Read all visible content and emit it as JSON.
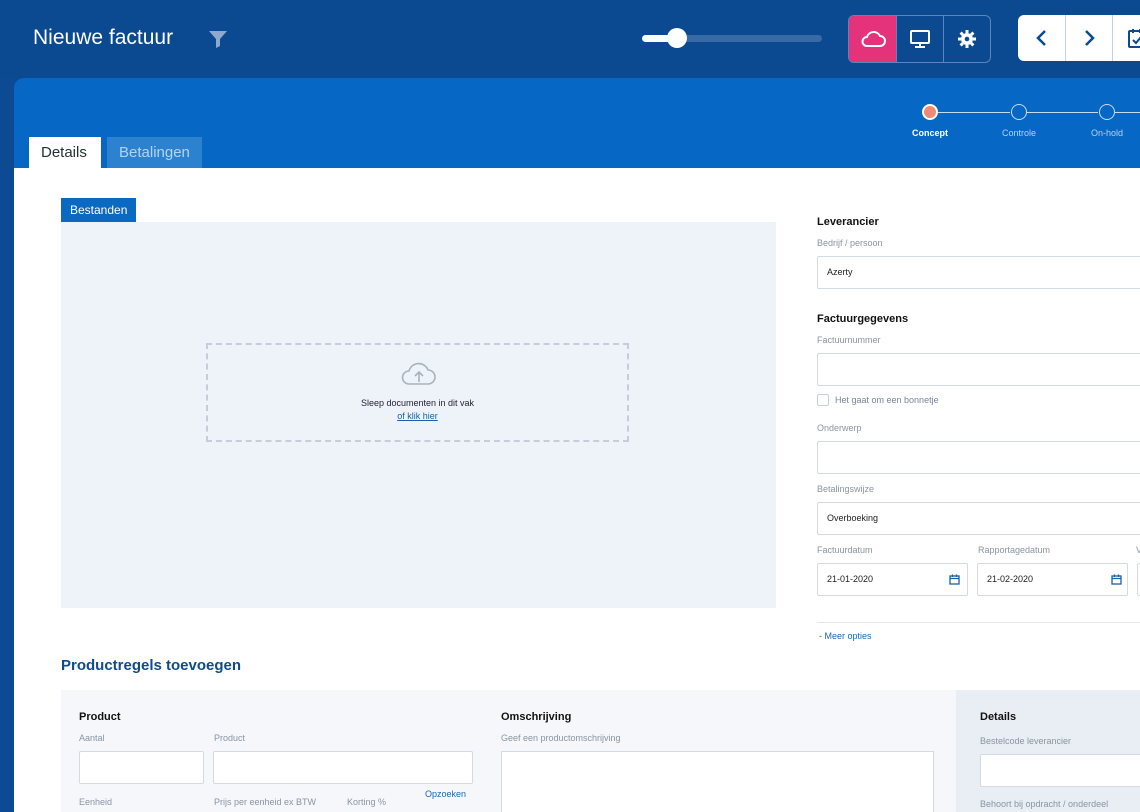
{
  "header": {
    "title": "Nieuwe factuur"
  },
  "tabs": [
    {
      "label": "Details",
      "active": true
    },
    {
      "label": "Betalingen",
      "active": false
    }
  ],
  "steps": [
    {
      "label": "Concept",
      "current": true
    },
    {
      "label": "Controle",
      "current": false
    },
    {
      "label": "On-hold",
      "current": false
    }
  ],
  "files": {
    "badge": "Bestanden",
    "drop_text": "Sleep documenten in dit vak",
    "drop_link": "of klik hier"
  },
  "supplier": {
    "heading": "Leverancier",
    "label": "Bedrijf / persoon",
    "value": "Azerty"
  },
  "invoice": {
    "heading": "Factuurgegevens",
    "number_label": "Factuurnummer",
    "number_value": "",
    "receipt_label": "Het gaat om een bonnetje",
    "subject_label": "Onderwerp",
    "subject_value": "",
    "payment_label": "Betalingswijze",
    "payment_value": "Overboeking",
    "invoice_date_label": "Factuurdatum",
    "invoice_date_value": "21-01-2020",
    "report_date_label": "Rapportagedatum",
    "report_date_value": "21-02-2020",
    "third_label_partial": "V",
    "more_options": "- Meer opties"
  },
  "products": {
    "section_title": "Productregels toevoegen",
    "product_heading": "Product",
    "amount_label": "Aantal",
    "product_label": "Product",
    "lookup_link": "Opzoeken",
    "unit_label": "Eenheid",
    "price_label": "Prijs per eenheid ex BTW",
    "discount_label": "Korting %",
    "description_heading": "Omschrijving",
    "description_label": "Geef een productomschrijving",
    "details_heading": "Details",
    "order_code_label": "Bestelcode leverancier",
    "belongs_label": "Behoort bij opdracht / onderdeel"
  },
  "colors": {
    "header_bg": "#0b4a91",
    "panel_blue": "#0767c4",
    "accent_pink": "#e5337b",
    "step_current": "#f08a74"
  }
}
